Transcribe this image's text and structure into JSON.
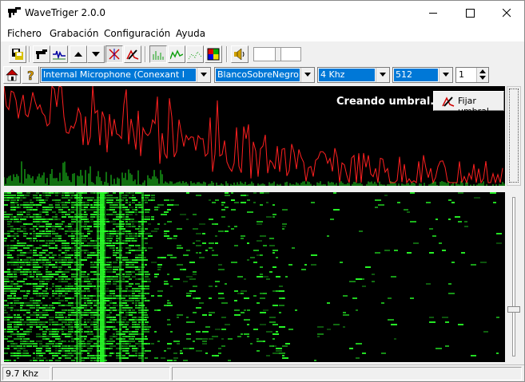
{
  "window": {
    "title": "WaveTriger 2.0.0"
  },
  "menu": {
    "items": [
      "Fichero",
      "Grabación",
      "Configuración",
      "Ayuda"
    ]
  },
  "controls": {
    "input_device": "Internal Microphone (Conexant I",
    "color_scheme": "BlancoSobreNegro",
    "sample_rate": "4 Khz",
    "fft_size": "512",
    "spin_value": "1"
  },
  "spectrum": {
    "status_text": "Creando umbral...",
    "threshold_button": "Fijar umbral",
    "line_color": "#ff2020",
    "bar_color": "#20e020"
  },
  "waterfall": {
    "color": "#28ff28"
  },
  "statusbar": {
    "frequency": "9.7 Khz"
  }
}
